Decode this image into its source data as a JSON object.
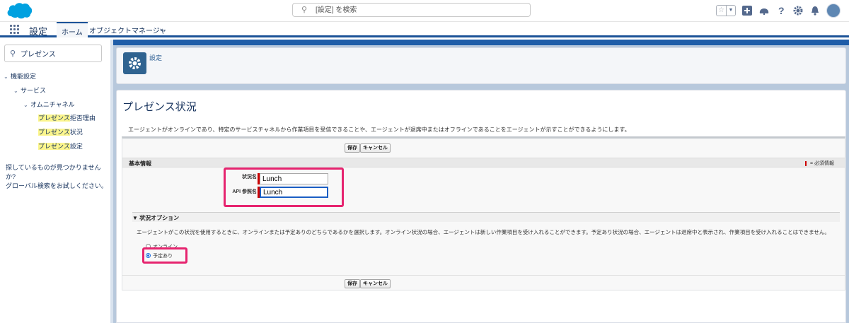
{
  "header": {
    "search_placeholder": "[設定] を検索",
    "icons": [
      "favorites-star-icon",
      "favorites-dropdown-icon",
      "add-icon",
      "trailhead-icon",
      "help-icon",
      "gear-icon",
      "bell-icon",
      "avatar"
    ]
  },
  "app_nav": {
    "app_name": "設定",
    "tabs": [
      {
        "label": "ホーム",
        "active": true
      },
      {
        "label": "オブジェクトマネージャ",
        "active": false
      }
    ]
  },
  "sidebar": {
    "quick_find_value": "プレゼンス",
    "tree": [
      {
        "label": "機能設定",
        "level": 0
      },
      {
        "label": "サービス",
        "level": 1
      },
      {
        "label": "オムニチャネル",
        "level": 2
      },
      {
        "label_highlight": "プレゼンス",
        "label_rest": "拒否理由",
        "level": 3
      },
      {
        "label_highlight": "プレゼンス",
        "label_rest": "状況",
        "level": 3
      },
      {
        "label_highlight": "プレゼンス",
        "label_rest": "設定",
        "level": 3
      }
    ],
    "help_line1": "探しているものが見つかりませんか?",
    "help_line2": "グローバル検索をお試しください。"
  },
  "setup_header": {
    "breadcrumb": "設定"
  },
  "page": {
    "title": "プレゼンス状況",
    "description": "エージェントがオンラインであり、特定のサービスチャネルから作業項目を受信できることや、エージェントが退席中またはオフラインであることをエージェントが示すことができるようにします。",
    "save_label": "保存",
    "cancel_label": "キャンセル",
    "section_title": "基本情報",
    "required_legend": "= 必須情報",
    "fields": {
      "status_name_label": "状況名",
      "status_name_value": "Lunch",
      "api_name_label": "API 参照名",
      "api_name_value": "Lunch"
    },
    "options_title": "状況オプション",
    "options_description": "エージェントがこの状況を使用するときに、オンラインまたは予定ありのどちらであるかを選択します。オンライン状況の場合、エージェントは新しい作業項目を受け入れることができます。予定あり状況の場合、エージェントは退席中と表示され、作業項目を受け入れることはできません。",
    "radio_online": "オンライン",
    "radio_busy": "予定あり",
    "selected_option": "予定あり"
  },
  "colors": {
    "brand_blue": "#1f5da8",
    "callout_pink": "#e6246f",
    "highlight_yellow": "#fbf58d",
    "required_red": "#cc0000"
  }
}
